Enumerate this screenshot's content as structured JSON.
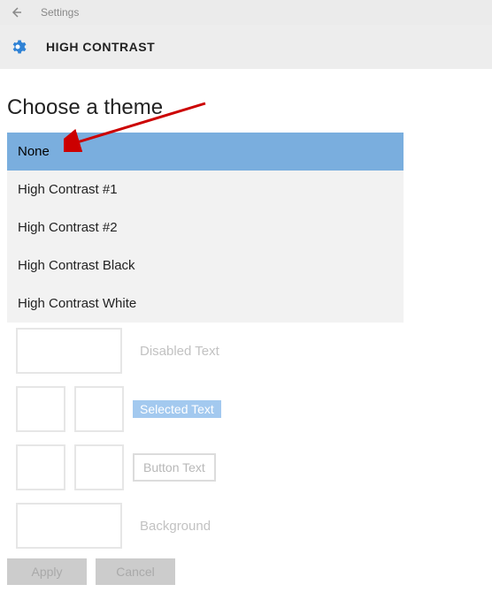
{
  "titlebar": {
    "title": "Settings"
  },
  "header": {
    "title": "HIGH CONTRAST"
  },
  "section": {
    "heading": "Choose a theme"
  },
  "dropdown": {
    "items": [
      {
        "label": "None"
      },
      {
        "label": "High Contrast #1"
      },
      {
        "label": "High Contrast #2"
      },
      {
        "label": "High Contrast Black"
      },
      {
        "label": "High Contrast White"
      }
    ]
  },
  "preview": {
    "disabled_text": "Disabled Text",
    "selected_text": "Selected Text",
    "button_text": "Button Text",
    "background": "Background"
  },
  "buttons": {
    "apply": "Apply",
    "cancel": "Cancel"
  },
  "colors": {
    "selected_bg": "#7aaede",
    "arrow": "#cc0000"
  }
}
